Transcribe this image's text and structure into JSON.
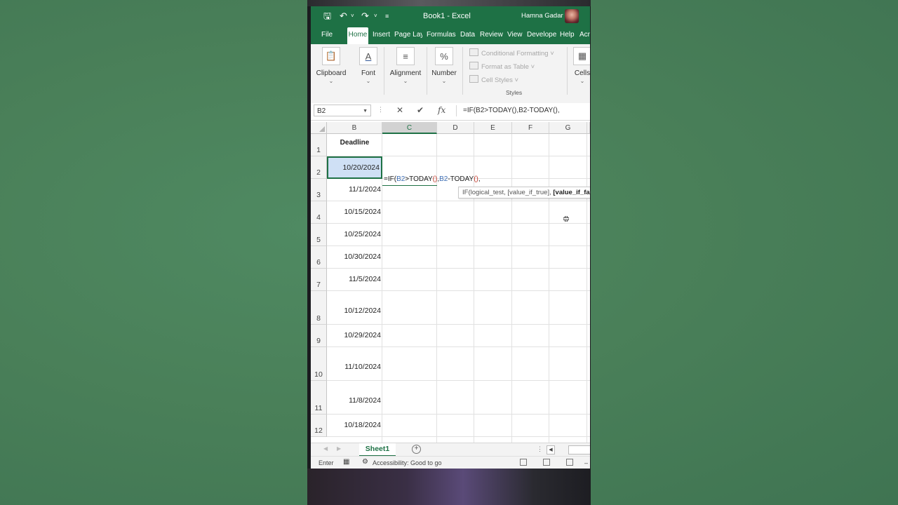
{
  "window": {
    "title": "Book1  -  Excel",
    "user": "Hamna Gadar"
  },
  "tabs": [
    "File",
    "Home",
    "Insert",
    "Page Layo",
    "Formulas",
    "Data",
    "Review",
    "View",
    "Develope",
    "Help",
    "Acr"
  ],
  "ribbon": {
    "clipboard": "Clipboard",
    "font": "Font",
    "alignment": "Alignment",
    "number": "Number",
    "conditional_formatting": "Conditional Formatting",
    "format_as_table": "Format as Table",
    "cell_styles": "Cell Styles",
    "styles": "Styles",
    "cells": "Cells"
  },
  "formula_bar": {
    "name_box": "B2",
    "formula": "=IF(B2>TODAY(),B2-TODAY(),"
  },
  "grid": {
    "columns": [
      "B",
      "C",
      "D",
      "E",
      "F",
      "G"
    ],
    "rows": [
      "1",
      "2",
      "3",
      "4",
      "5",
      "6",
      "7",
      "8",
      "9",
      "10",
      "11",
      "12"
    ],
    "header_cell": "Deadline",
    "dates": [
      "10/20/2024",
      "11/1/2024",
      "10/15/2024",
      "10/25/2024",
      "10/30/2024",
      "11/5/2024",
      "10/12/2024",
      "10/29/2024",
      "11/10/2024",
      "11/8/2024",
      "10/18/2024"
    ],
    "editor": {
      "p1": "=IF(",
      "p2": "B2",
      "p3": ">TODAY",
      "p4": "()",
      "p5": ",",
      "p6": "B2",
      "p7": "-TODAY",
      "p8": "()",
      "p9": ","
    },
    "tooltip": {
      "args": "IF(logical_test, [value_if_true], ",
      "current": "[value_if_fa"
    }
  },
  "sheet": {
    "tab": "Sheet1"
  },
  "status": {
    "mode": "Enter",
    "accessibility": "Accessibility: Good to go"
  },
  "colors": {
    "excel_green": "#1e7145",
    "selection_blue": "#cfe0f5",
    "ref_blue": "#3f6fb5",
    "paren_red": "#c0392b"
  }
}
